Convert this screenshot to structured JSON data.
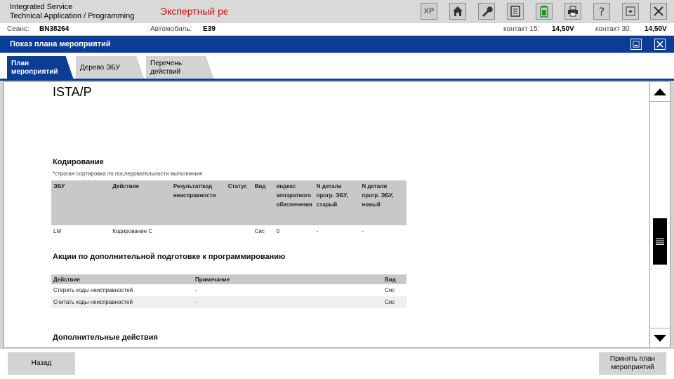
{
  "app": {
    "title_line1": "Integrated Service",
    "title_line2": "Technical Application / Programming",
    "mode": "Экспертный ре"
  },
  "toolbar": {
    "xp_label": "XP",
    "icons": [
      "home-icon",
      "wrench-icon",
      "ecu-icon",
      "battery-icon",
      "printer-icon",
      "help-icon",
      "download-icon",
      "close-icon"
    ],
    "battery_color": "#1a9a1a"
  },
  "session": {
    "session_label": "Сеанс:",
    "session_value": "BN38264",
    "vehicle_label": "Автомобиль:",
    "vehicle_value": "E39",
    "kl15_label": "контакт 15:",
    "kl15_value": "14,50V",
    "kl30_label": "контакт 30:",
    "kl30_value": "14,50V"
  },
  "window": {
    "title": "Показ плана мероприятий",
    "accent": "#0b3c96"
  },
  "tabs": [
    {
      "line1": "План",
      "line2": "мероприятий",
      "active": true
    },
    {
      "line1": "Дерево ЭБУ",
      "line2": "",
      "active": false
    },
    {
      "line1": "Перечень",
      "line2": "действий",
      "active": false
    }
  ],
  "content": {
    "brand": "ISTA/P",
    "coding": {
      "title": "Кодирование",
      "note": "*строгая сортировка по последовательности выполнения",
      "headers": [
        "ЭБУ",
        "Действие",
        "Результат/код неисправности",
        "Статус",
        "Вид",
        "индекс аппаратного обеспечения",
        "N детали прогр. ЭБУ, старый",
        "N детали прогр. ЭБУ, новый"
      ],
      "rows": [
        [
          "LM",
          "Кодирование C",
          "",
          "",
          "Сис",
          "0",
          "-",
          "-"
        ]
      ]
    },
    "prep": {
      "title": "Акции по дополнительной подготовке к программированию",
      "headers": [
        "Действие",
        "Примечание",
        "Вид"
      ],
      "rows": [
        [
          "Стереть коды неисправностей",
          "-",
          "Сис"
        ],
        [
          "Считать коды неисправностей",
          "-",
          "Сис"
        ]
      ]
    },
    "extra": {
      "title": "Дополнительные действия"
    }
  },
  "buttons": {
    "back": "Назад",
    "accept_line1": "Принять план",
    "accept_line2": "мероприятий"
  }
}
